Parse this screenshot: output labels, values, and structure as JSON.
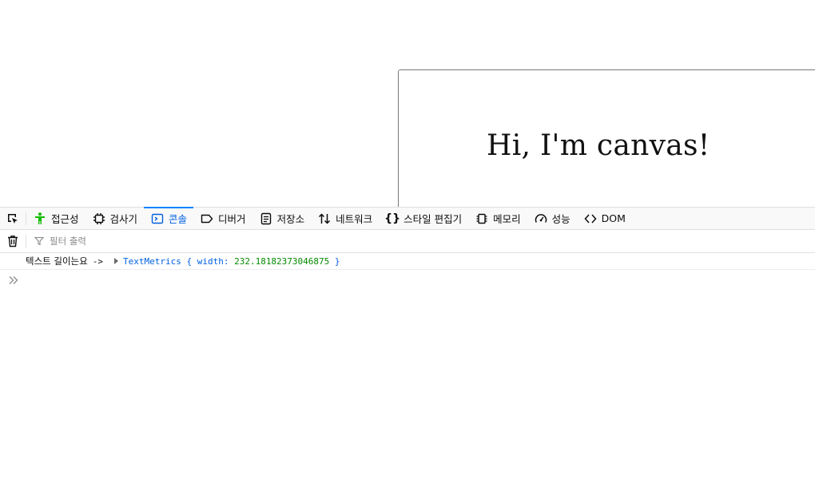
{
  "page": {
    "canvas_text": "Hi, I'm canvas!"
  },
  "toolbar": {
    "tabs": [
      {
        "label": "접근성",
        "icon": "accessibility-icon"
      },
      {
        "label": "검사기",
        "icon": "inspector-icon"
      },
      {
        "label": "콘솔",
        "icon": "console-icon",
        "selected": true
      },
      {
        "label": "디버거",
        "icon": "debugger-icon"
      },
      {
        "label": "저장소",
        "icon": "storage-icon"
      },
      {
        "label": "네트워크",
        "icon": "network-icon"
      },
      {
        "label": "스타일 편집기",
        "icon": "style-editor-icon"
      },
      {
        "label": "메모리",
        "icon": "memory-icon"
      },
      {
        "label": "성능",
        "icon": "performance-icon"
      },
      {
        "label": "DOM",
        "icon": "dom-icon"
      }
    ]
  },
  "filter": {
    "placeholder": "필터 출력"
  },
  "console": {
    "log": {
      "message": "텍스트 길이는요",
      "arrow": "->",
      "object_class": "TextMetrics",
      "open_brace": "{",
      "key": "width:",
      "value": "232.18182373046875",
      "close_brace": "}"
    }
  },
  "colors": {
    "accent": "#0a84ff",
    "selected_text": "#0061e0",
    "number": "#058b00",
    "accessibility_green": "#12bc00"
  }
}
